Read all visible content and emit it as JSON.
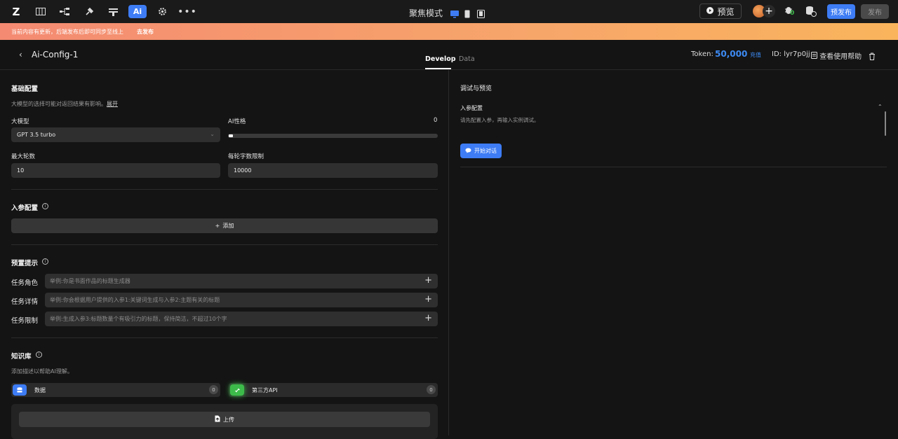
{
  "topbar": {
    "logo": "Z",
    "tools": [
      "pages-icon",
      "flow-icon",
      "plugin-icon",
      "layout-icon",
      "ai-icon",
      "settings-icon",
      "more-icon"
    ],
    "ai_label": "Ai",
    "focus_mode_label": "聚焦模式",
    "preview_label": "预览",
    "prepublish_label": "预发布",
    "publish_label": "发布",
    "debug_badge_count": "0"
  },
  "banner": {
    "text": "当前内容有更新，后端发布后即可同步至线上",
    "link": "去发布"
  },
  "header": {
    "title": "Ai-Config-1",
    "tabs": [
      {
        "label": "Develop",
        "active": true
      },
      {
        "label": "Data",
        "active": false
      }
    ],
    "token_label": "Token:",
    "token_value": "50,000",
    "recharge_label": "充值",
    "id_label": "ID: lyr7p0jj",
    "help_label": "查看使用帮助"
  },
  "basic": {
    "title": "基础配置",
    "desc": "大模型的选择可能对返回结果有影响。",
    "expand": "展开",
    "model_label": "大模型",
    "model_value": "GPT 3.5 turbo",
    "personality_label": "AI性格",
    "personality_value": "0",
    "rounds_label": "最大轮数",
    "rounds_value": "10",
    "words_label": "每轮字数限制",
    "words_value": "10000"
  },
  "params": {
    "title": "入参配置",
    "add_label": "添加"
  },
  "prompts": {
    "title": "预置提示",
    "rows": [
      {
        "label": "任务角色",
        "placeholder": "举例:你是书面作品的标题生成器"
      },
      {
        "label": "任务详情",
        "placeholder": "举例:你会根据用户提供的入参1:关键词生成与入参2:主题有关的标题"
      },
      {
        "label": "任务限制",
        "placeholder": "举例:生成入参3:标题数量个有吸引力的标题，保持简洁，不超过10个字"
      }
    ]
  },
  "knowledge": {
    "title": "知识库",
    "desc": "添加描述以帮助AI理解。",
    "cards": [
      {
        "label": "数据",
        "count": "0",
        "color": "#3d7cf4"
      },
      {
        "label": "第三方API",
        "count": "0",
        "color": "#3dbb4a"
      }
    ],
    "upload_label": "上传"
  },
  "debug": {
    "title": "调试与预览",
    "params_title": "入参配置",
    "hint": "请先配置入参，再输入实例调试。",
    "start_chat_label": "开始对话"
  }
}
